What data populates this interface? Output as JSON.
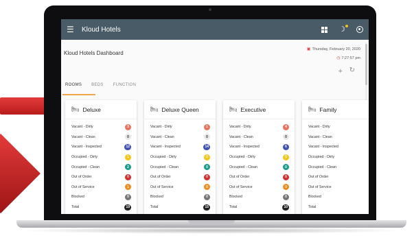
{
  "app": {
    "title": "Kloud Hotels",
    "dashboard_title": "Kloud Hotels Dashboard",
    "date": "Thursday, February 20, 2020",
    "time": "7:27:57 pm"
  },
  "icons": {
    "menu": "hamburger-icon",
    "grid": "grid-icon",
    "theme": "moon-icon",
    "account": "account-icon",
    "calendar": "calendar-icon",
    "clock": "clock-icon",
    "add": "plus-icon",
    "refresh": "refresh-icon",
    "room": "bed-icon"
  },
  "colors": {
    "appbar": "#495b66",
    "tab_indicator": "#f0a54a",
    "vacant_dirty": "#e8735e",
    "vacant_clean": "#e6e6e6",
    "vacant_inspected": "#3f51b5",
    "occupied_dirty": "#f5c518",
    "occupied_clean": "#1a9c8a",
    "out_of_order": "#d32f2f",
    "out_of_service": "#f28b1e",
    "blocked": "#757575",
    "total": "#222222"
  },
  "tabs": [
    {
      "label": "ROOMS",
      "active": true
    },
    {
      "label": "BEDS",
      "active": false
    },
    {
      "label": "FUNCTION",
      "active": false
    }
  ],
  "row_labels": [
    "Vacant - Dirty",
    "Vacant - Clean",
    "Vacant - Inspected",
    "Occupied - Dirty",
    "Occupied - Clean",
    "Out of Order",
    "Out of Service",
    "Blocked",
    "Total"
  ],
  "cards": [
    {
      "title": "Deluxe",
      "values": [
        "3",
        "0",
        "12",
        "1",
        "2",
        "0",
        "1",
        "0",
        "19"
      ]
    },
    {
      "title": "Deluxe Queen",
      "values": [
        "1",
        "0",
        "14",
        "0",
        "0",
        "0",
        "0",
        "0",
        "15"
      ]
    },
    {
      "title": "Executive",
      "values": [
        "4",
        "0",
        "6",
        "0",
        "0",
        "0",
        "0",
        "0",
        "10"
      ]
    },
    {
      "title": "Family",
      "values": []
    }
  ]
}
